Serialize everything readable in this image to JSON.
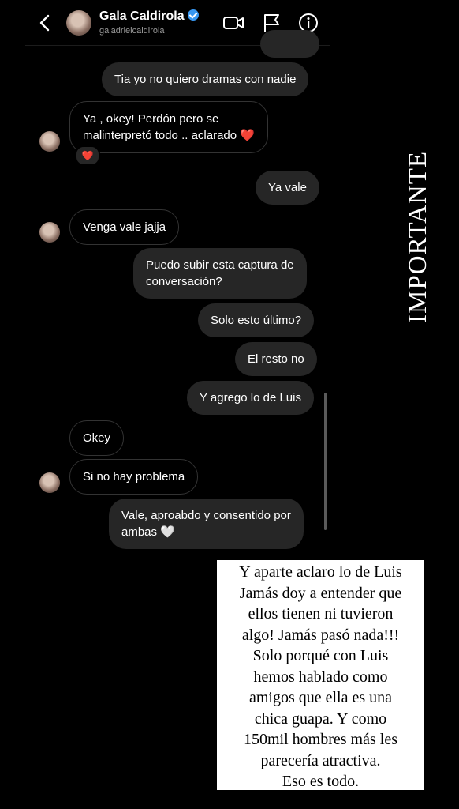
{
  "header": {
    "name": "Gala Caldirola",
    "username": "galadrielcaldirola"
  },
  "messages": [
    {
      "dir": "out",
      "text": "Tia yo no quiero dramas con nadie"
    },
    {
      "dir": "in",
      "lines": [
        "Ya , okey! Perdón pero se",
        "malinterpretó todo .. aclarado ❤️"
      ],
      "reaction": "❤️"
    },
    {
      "dir": "out",
      "text": "Ya vale"
    },
    {
      "dir": "in",
      "text": "Venga vale jajja"
    },
    {
      "dir": "out",
      "lines": [
        "Puedo subir esta captura de",
        "conversación?"
      ]
    },
    {
      "dir": "out",
      "text": "Solo esto último?"
    },
    {
      "dir": "out",
      "text": "El resto no"
    },
    {
      "dir": "out",
      "text": "Y agrego lo de Luis"
    },
    {
      "dir": "in",
      "text": "Okey"
    },
    {
      "dir": "in",
      "text": "Si no hay problema"
    },
    {
      "dir": "out",
      "lines": [
        "Vale, aproabdo y consentido por",
        "ambas 🤍"
      ]
    }
  ],
  "overlay": {
    "vertical_text": "IMPORTANTE",
    "note_lines": [
      "Y aparte aclaro lo de Luis",
      "Jamás doy a entender que",
      "ellos tienen ni tuvieron",
      "algo! Jamás pasó nada!!!",
      "Solo porqué con Luis",
      "hemos hablado como",
      "amigos que ella es una",
      "chica guapa. Y como",
      "150mil hombres más les",
      "parecería atractiva.",
      "Eso es todo."
    ]
  }
}
